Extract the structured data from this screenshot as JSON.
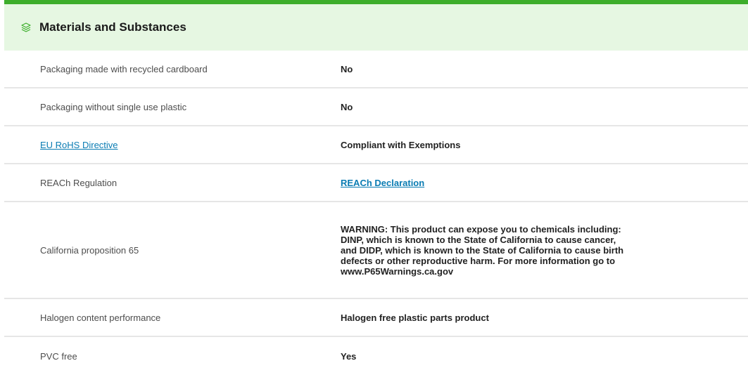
{
  "section": {
    "title": "Materials and Substances",
    "icon": "layers-icon",
    "accent_color": "#3dae2b",
    "header_bg": "#e6f7e2"
  },
  "rows": [
    {
      "label": "Packaging made with recycled cardboard",
      "value": "No"
    },
    {
      "label": "Packaging without single use plastic",
      "value": "No"
    },
    {
      "label": "EU RoHS Directive",
      "value": "Compliant with Exemptions"
    },
    {
      "label": "REACh Regulation",
      "value": "REACh Declaration"
    },
    {
      "label": "California proposition 65",
      "value": "WARNING: This product can expose you to chemicals including: DINP, which is known to the State of California to cause cancer, and DIDP, which is known to the State of California to cause birth defects or other reproductive harm. For more information go to www.P65Warnings.ca.gov"
    },
    {
      "label": "Halogen content performance",
      "value": "Halogen free plastic parts product"
    },
    {
      "label": "PVC free",
      "value": "Yes"
    }
  ]
}
